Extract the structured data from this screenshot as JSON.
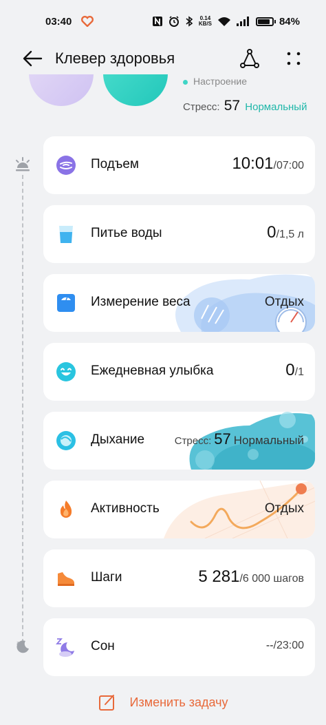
{
  "status_bar": {
    "time": "03:40",
    "net_speed_top": "0.14",
    "net_speed_bottom": "KB/S",
    "battery": "84%"
  },
  "header": {
    "title": "Клевер здоровья",
    "icons": [
      "back-arrow-icon",
      "share-icon",
      "more-icon"
    ]
  },
  "summary": {
    "mood_partial": "Настроение",
    "stress_label": "Стресс:",
    "stress_value": "57",
    "stress_state": "Нормальный",
    "colors": {
      "mood": "#cfc2f2",
      "stress": "#22c7ba",
      "stress_text": "#1fb7a9"
    }
  },
  "tasks": [
    {
      "label": "Подъем",
      "value": "10:01",
      "target": "/07:00",
      "icon": "wake-up-icon"
    },
    {
      "label": "Питье воды",
      "value": "0",
      "target": "/1,5 л",
      "icon": "water-glass-icon"
    },
    {
      "label": "Измерение веса",
      "value": "Отдых",
      "icon": "scale-icon"
    },
    {
      "label": "Ежедневная улыбка",
      "value": "0",
      "target": "/1",
      "icon": "smile-icon"
    },
    {
      "label": "Дыхание",
      "stress_label": "Стресс:",
      "stress_value": "57",
      "stress_state": "Нормальный",
      "icon": "breathing-icon"
    },
    {
      "label": "Активность",
      "value": "Отдых",
      "icon": "flame-icon"
    },
    {
      "label": "Шаги",
      "value": "5 281",
      "target": "/6 000 шагов",
      "icon": "shoe-icon"
    },
    {
      "label": "Сон",
      "value": "--",
      "target": "/23:00",
      "icon": "sleep-icon"
    }
  ],
  "edit_task": {
    "label": "Изменить задачу"
  },
  "colors": {
    "accent": "#e8693a",
    "background": "#f1f2f4"
  }
}
